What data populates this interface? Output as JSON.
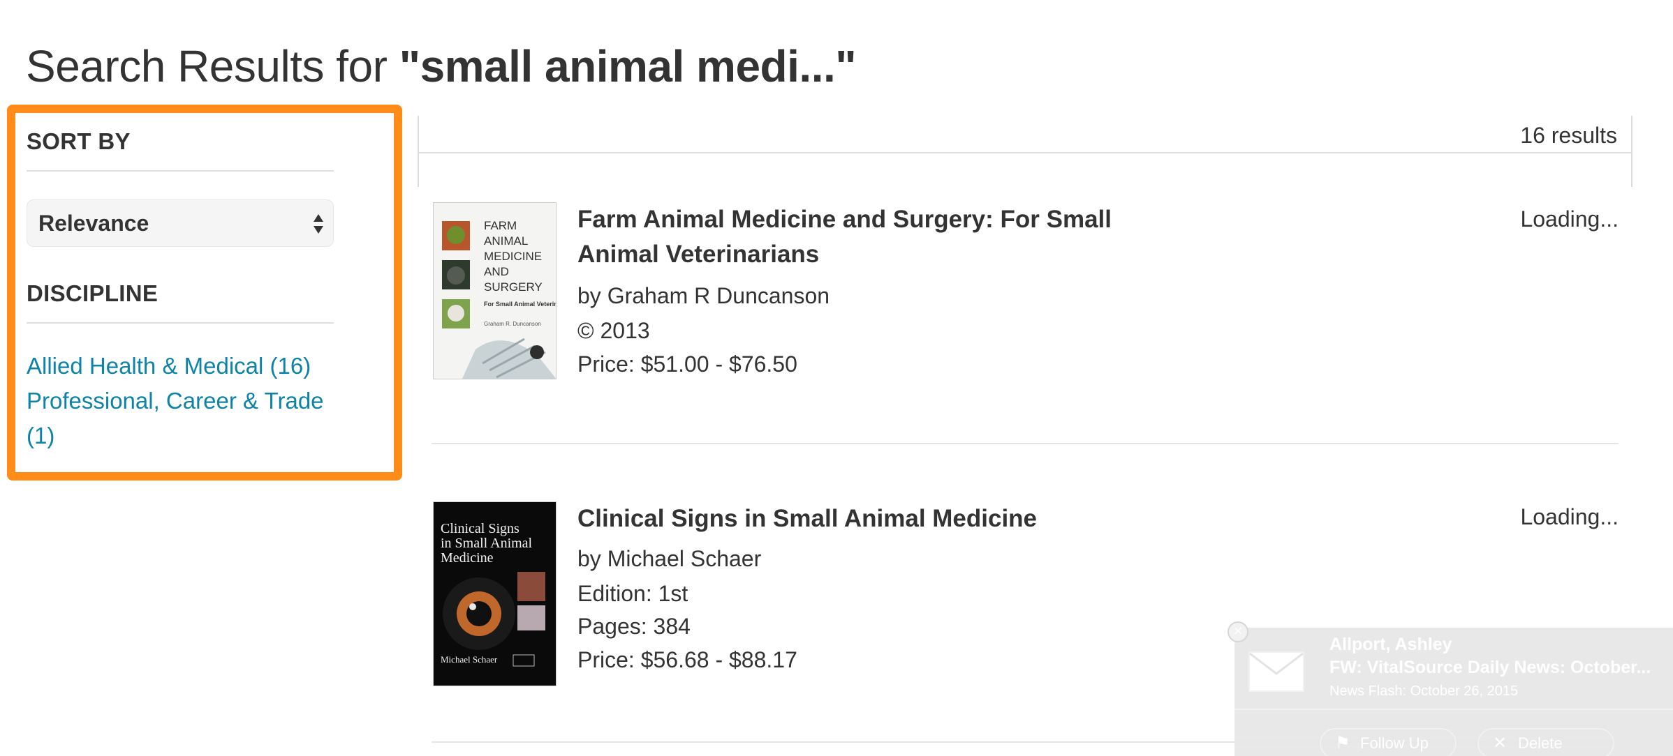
{
  "header": {
    "title_prefix": "Search Results for ",
    "query": "\"small animal medi...\""
  },
  "sidebar": {
    "sort_heading": "SORT BY",
    "sort_value": "Relevance",
    "discipline_heading": "DISCIPLINE",
    "disciplines": [
      "Allied Health & Medical (16)",
      "Professional, Career & Trade (1)"
    ],
    "highlight_color": "#ff8c19",
    "link_color": "#0e82a8"
  },
  "results": {
    "count": "16 results",
    "items": [
      {
        "title": "Farm Animal Medicine and Surgery: For Small Animal Veterinarians",
        "author": "by Graham R Duncanson",
        "copyright": "©  2013",
        "price": "Price:  $51.00 - $76.50",
        "status": "Loading...",
        "cover": {
          "line1": "FARM",
          "line2": "ANIMAL",
          "line3": "MEDICINE",
          "line4": "AND",
          "line5": "SURGERY",
          "subtitle": "For Small Animal Veterinarians",
          "author": "Graham R. Duncanson"
        }
      },
      {
        "title": "Clinical Signs in Small Animal Medicine",
        "author": "by Michael Schaer",
        "edition": "Edition:  1st",
        "pages": "Pages:  384",
        "price": "Price:  $56.68 - $88.17",
        "status": "Loading...",
        "cover": {
          "line1": "Clinical Signs",
          "line2": "in Small Animal",
          "line3": "Medicine",
          "author": "Michael Schaer"
        }
      }
    ]
  },
  "notification": {
    "sender": "Allport, Ashley",
    "subject": "FW: VitalSource Daily News: October...",
    "preview": "News Flash: October 26, 2015",
    "follow_up": "Follow Up",
    "delete": "Delete",
    "close_glyph": "×"
  }
}
